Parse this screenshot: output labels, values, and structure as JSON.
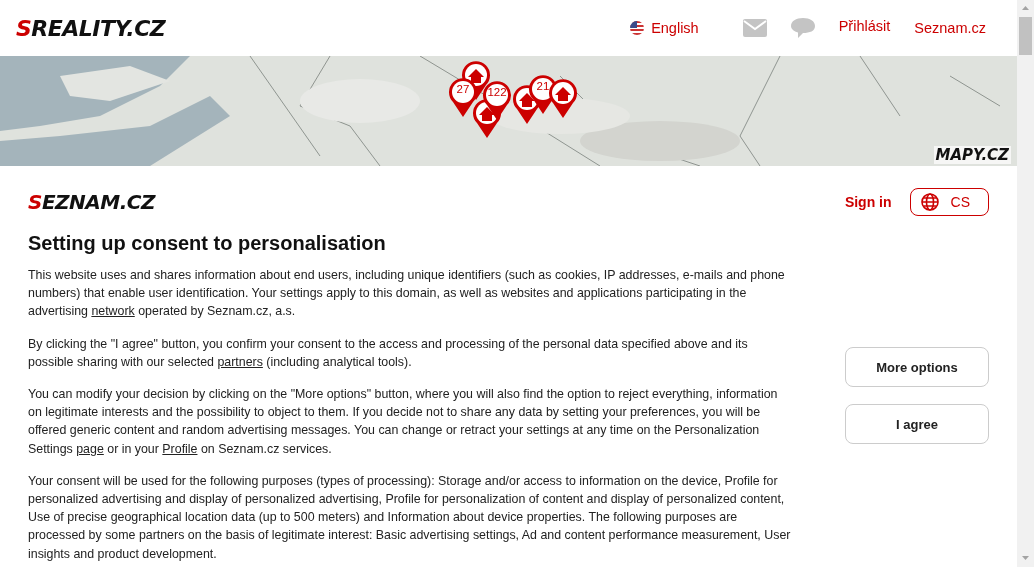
{
  "header": {
    "logo": "SREALITY.CZ",
    "language": "English",
    "links": [
      "Přihlásit",
      "Seznam.cz"
    ]
  },
  "map": {
    "logo": "MAPY.CZ",
    "pins": [
      {
        "kind": "house"
      },
      {
        "kind": "count",
        "label": "27"
      },
      {
        "kind": "house"
      },
      {
        "kind": "count",
        "label": "122"
      },
      {
        "kind": "house"
      },
      {
        "kind": "count",
        "label": "21"
      },
      {
        "kind": "house"
      }
    ]
  },
  "consent": {
    "logo": "SEZNAM.CZ",
    "sign_in": "Sign in",
    "language": "CS",
    "title": "Setting up consent to personalisation",
    "paragraphs": [
      [
        {
          "text": "This website uses and shares information about end users, including unique identifiers (such as cookies, IP addresses, e-mails and phone numbers) that enable user identification. Your settings apply to this domain, as well as websites and applications participating in the advertising "
        },
        {
          "link": "network"
        },
        {
          "text": " operated by Seznam.cz, a.s."
        }
      ],
      [
        {
          "text": "By clicking the \"I agree\" button, you confirm your consent to the access and processing of the personal data specified above and its possible sharing with our selected "
        },
        {
          "link": "partners"
        },
        {
          "text": " (including analytical tools)."
        }
      ],
      [
        {
          "text": "You can modify your decision by clicking on the \"More options\" button, where you will also find the option to reject everything, information on legitimate interests and the possibility to object to them. If you decide not to share any data by setting your preferences, you will be offered generic content and random advertising messages. You can change or retract your settings at any time on the Personalization Settings "
        },
        {
          "link": "page"
        },
        {
          "text": " or in your "
        },
        {
          "link": "Profile"
        },
        {
          "text": " on Seznam.cz services."
        }
      ],
      [
        {
          "text": "Your consent will be used for the following purposes (types of processing): Storage and/or access to information on the device, Profile for personalized advertising and display of personalized advertising, Profile for personalization of content and display of personalized content, Use of precise geographical location data (up to 500 meters) and Information about device properties. The following purposes are processed by some partners on the basis of legitimate interest: Basic advertising settings, Ad and content performance measurement, User insights and product development."
        }
      ]
    ],
    "buttons": [
      "More options",
      "I agree"
    ]
  }
}
